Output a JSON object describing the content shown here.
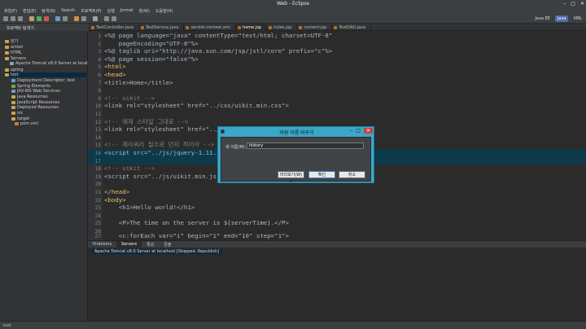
{
  "window": {
    "title": "Web - Eclipse",
    "min": "–",
    "max": "□",
    "close": "✕"
  },
  "menu": [
    "파일(F)",
    "편집(E)",
    "탐색(N)",
    "Search",
    "프로젝트(P)",
    "실행",
    "Jmmel",
    "창(W)",
    "도움말(H)"
  ],
  "perspectives": [
    "Java EE",
    "Java",
    "XML"
  ],
  "explorer": {
    "title": "프로젝트 탐색기",
    "items": [
      {
        "label": "암기",
        "indent": 0
      },
      {
        "label": "action",
        "indent": 0
      },
      {
        "label": "HTML",
        "indent": 0
      },
      {
        "label": "Servers",
        "indent": 0
      },
      {
        "label": "Apache Tomcat v8.0 Server at localhost",
        "indent": 1
      },
      {
        "label": "spring",
        "indent": 0
      },
      {
        "label": "test",
        "indent": 0
      },
      {
        "label": "Deployment Descriptor: test",
        "indent": 1
      },
      {
        "label": "Spring Elements",
        "indent": 1
      },
      {
        "label": "JAX-WS Web Services",
        "indent": 1
      },
      {
        "label": "Java Resources",
        "indent": 1
      },
      {
        "label": "JavaScript Resources",
        "indent": 1
      },
      {
        "label": "Deployed Resources",
        "indent": 1
      },
      {
        "label": "src",
        "indent": 1
      },
      {
        "label": "target",
        "indent": 1
      },
      {
        "label": "pom.xml",
        "indent": 1
      }
    ]
  },
  "editor_tabs": [
    "TestController.java",
    "TestService.java",
    "servlet-context.xml",
    "home.jsp",
    "index.jsp",
    "content.jsp",
    "TestDAO.java"
  ],
  "code_lines": [
    {
      "n": "1",
      "text": "<%@ page language=\"java\" contentType=\"text/html; charset=UTF-8\""
    },
    {
      "n": "2",
      "text": "    pageEncoding=\"UTF-8\"%>"
    },
    {
      "n": "3",
      "text": "<%@ taglib uri=\"http://java.sun.com/jsp/jstl/core\" prefix=\"c\"%>"
    },
    {
      "n": "4",
      "text": "<%@ page session=\"false\"%>"
    },
    {
      "n": "5",
      "text": "<html>"
    },
    {
      "n": "6",
      "text": "<head>"
    },
    {
      "n": "7",
      "text": "<title>Home</title>"
    },
    {
      "n": "8",
      "text": ""
    },
    {
      "n": "9",
      "text": "<!-- uikit -->"
    },
    {
      "n": "10",
      "text": "<link rel=\"stylesheet\" href=\"../css/uikit.min.css\">"
    },
    {
      "n": "11",
      "text": ""
    },
    {
      "n": "12",
      "text": "<!-- 예제 스타일 그대로 -->"
    },
    {
      "n": "13",
      "text": "<link rel=\"stylesheet\" href=\"../css/uikit.docs.min.css\">"
    },
    {
      "n": "14",
      "text": ""
    },
    {
      "n": "15",
      "text": "<!-- 제이쿼리 필수로 먼저 적어야 -->"
    },
    {
      "n": "16",
      "text": "<script src=\"../js/jquery-1.11."
    },
    {
      "n": "17",
      "text": ""
    },
    {
      "n": "18",
      "text": "<!-- uikit -->"
    },
    {
      "n": "19",
      "text": "<script src=\"../js/uikit.min.js"
    },
    {
      "n": "20",
      "text": ""
    },
    {
      "n": "21",
      "text": "</head>"
    },
    {
      "n": "22",
      "text": "<body>"
    },
    {
      "n": "23",
      "text": "    <h1>Hello world!</h1>"
    },
    {
      "n": "24",
      "text": ""
    },
    {
      "n": "25",
      "text": "    <P>The time on the server is ${serverTime}.</P>"
    },
    {
      "n": "26",
      "text": ""
    },
    {
      "n": "27",
      "text": "    <c:forEach var=\"i\" begin=\"1\" end=\"10\" step=\"1\">"
    }
  ],
  "dialog": {
    "title": "자원 이름 바꾸기",
    "label": "새 이름(M):",
    "value": "history",
    "buttons": [
      "미리보기(W) >",
      "확인",
      "취소"
    ]
  },
  "bottom_tabs": [
    "Problems",
    "Servers",
    "특성",
    "콘솔"
  ],
  "servers": {
    "row": "Apache Tomcat v8.0 Server at localhost  [Stopped, Republish]"
  },
  "status": {
    "text": "test"
  }
}
